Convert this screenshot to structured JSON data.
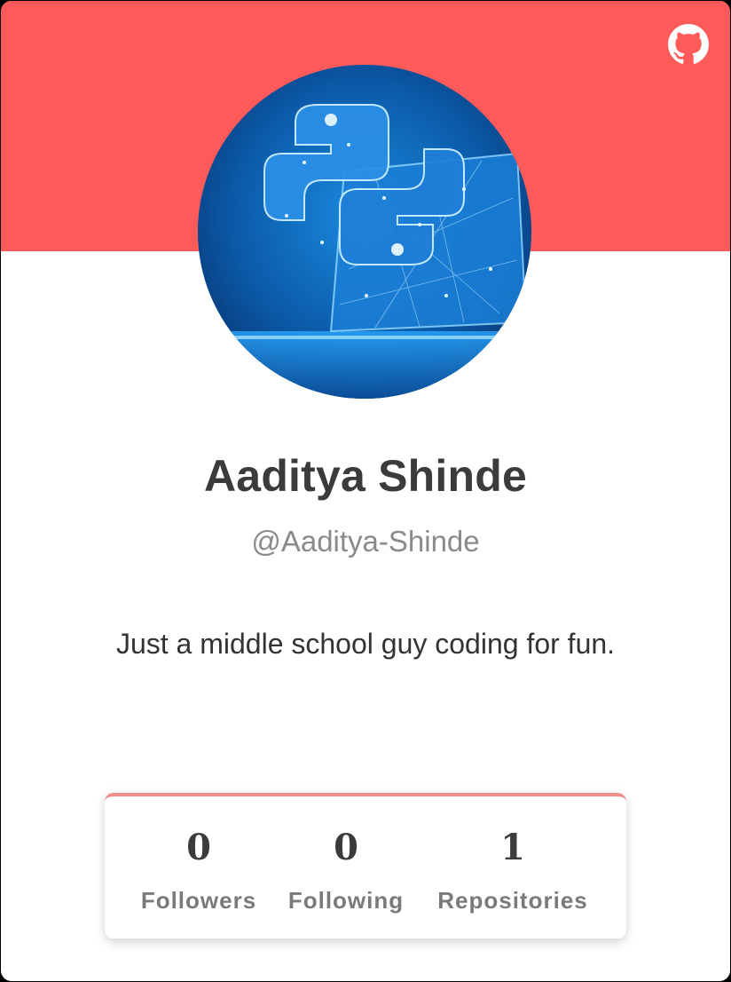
{
  "colors": {
    "banner": "#ff5a5a",
    "accent_border": "#f08c8c",
    "name": "#3b3b3b",
    "handle": "#8a8a8a"
  },
  "header": {
    "github_icon": "github-icon"
  },
  "profile": {
    "name": "Aaditya Shinde",
    "handle": "@Aaditya-Shinde",
    "bio": "Just a middle school guy coding for fun."
  },
  "stats": {
    "followers": {
      "value": "0",
      "label": "Followers"
    },
    "following": {
      "value": "0",
      "label": "Following"
    },
    "repositories": {
      "value": "1",
      "label": "Repositories"
    }
  }
}
